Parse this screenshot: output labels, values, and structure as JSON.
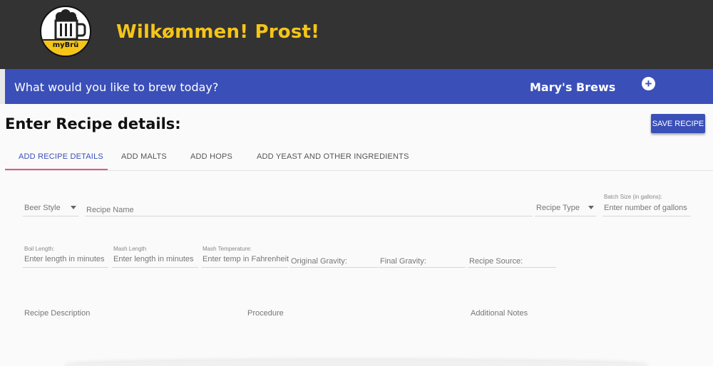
{
  "header": {
    "logo_text": "myBrü",
    "welcome": "Wilkømmen! Prost!",
    "colors": {
      "background": "#333333",
      "welcome": "#f5c518"
    }
  },
  "bluebar": {
    "question": "What would you like to brew today?",
    "brews_label": "Mary's Brews",
    "plus_icon": "+",
    "color": "#3a4fb8"
  },
  "page": {
    "title": "Enter Recipe details:",
    "save_label": "SAVE RECIPE"
  },
  "tabs": [
    {
      "label": "ADD RECIPE DETAILS"
    },
    {
      "label": "ADD MALTS"
    },
    {
      "label": "ADD HOPS"
    },
    {
      "label": "ADD YEAST AND OTHER INGREDIENTS"
    }
  ],
  "form": {
    "beer_style": {
      "value": "Beer Style"
    },
    "recipe_name": {
      "placeholder": "Recipe Name"
    },
    "recipe_type": {
      "value": "Recipe Type"
    },
    "batch_size": {
      "label": "Batch Size (in gallons):",
      "placeholder": "Enter number of gallons"
    },
    "boil_length": {
      "label": "Boil Length:",
      "placeholder": "Enter length in minutes"
    },
    "mash_length": {
      "label": "Mash Length",
      "placeholder": "Enter length in minutes"
    },
    "mash_temperature": {
      "label": "Mash Temperature:",
      "placeholder": "Enter temp in Fahrenheit"
    },
    "original_gravity": {
      "placeholder": "Original Gravity:"
    },
    "final_gravity": {
      "placeholder": "Final Gravity:"
    },
    "recipe_source": {
      "placeholder": "Recipe Source:"
    },
    "recipe_description": {
      "placeholder": "Recipe Description"
    },
    "procedure": {
      "placeholder": "Procedure"
    },
    "additional_notes": {
      "placeholder": "Additional Notes"
    }
  }
}
